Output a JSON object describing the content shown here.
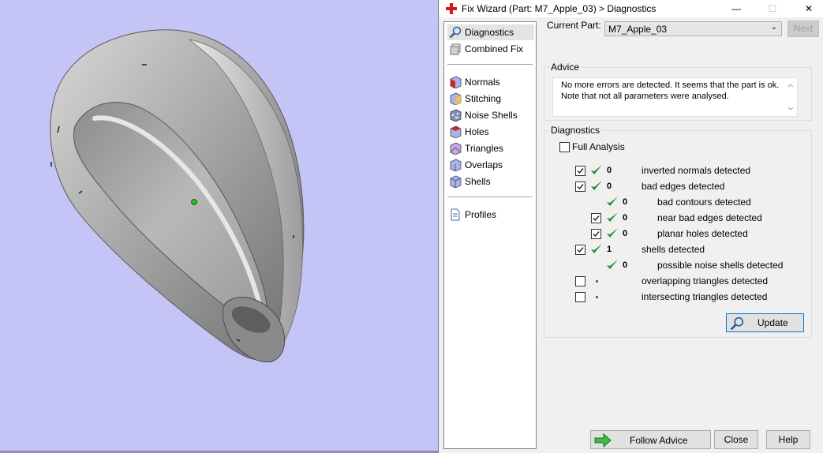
{
  "window": {
    "title": "Fix Wizard (Part: M7_Apple_03) > Diagnostics",
    "minimize": "—",
    "maximize": "☐",
    "close": "✕"
  },
  "nav": {
    "items": [
      {
        "label": "Diagnostics",
        "icon": "magnifier-icon"
      },
      {
        "label": "Combined Fix",
        "icon": "combined-fix-icon"
      },
      {
        "label": "Normals",
        "icon": "normals-icon"
      },
      {
        "label": "Stitching",
        "icon": "stitching-icon"
      },
      {
        "label": "Noise Shells",
        "icon": "noise-shells-icon"
      },
      {
        "label": "Holes",
        "icon": "holes-icon"
      },
      {
        "label": "Triangles",
        "icon": "triangles-icon"
      },
      {
        "label": "Overlaps",
        "icon": "overlaps-icon"
      },
      {
        "label": "Shells",
        "icon": "shells-icon"
      },
      {
        "label": "Profiles",
        "icon": "profiles-icon"
      }
    ],
    "selected": "Diagnostics"
  },
  "header": {
    "current_part_label": "Current Part:",
    "current_part_value": "M7_Apple_03",
    "next_label": "Next"
  },
  "advice": {
    "title": "Advice",
    "line1": "No more errors are detected. It seems that the part is ok.",
    "line2": "Note that not all parameters were analysed."
  },
  "diagnostics": {
    "title": "Diagnostics",
    "full_analysis_label": "Full Analysis",
    "full_analysis_checked": false,
    "rows": [
      {
        "text": "inverted normals detected",
        "count": "0",
        "checkbox": true,
        "checked": true,
        "status": "ok",
        "indent": 0
      },
      {
        "text": "bad edges detected",
        "count": "0",
        "checkbox": true,
        "checked": true,
        "status": "ok",
        "indent": 0
      },
      {
        "text": "bad contours detected",
        "count": "0",
        "checkbox": false,
        "checked": false,
        "status": "ok",
        "indent": 1
      },
      {
        "text": "near bad edges detected",
        "count": "0",
        "checkbox": true,
        "checked": true,
        "status": "ok",
        "indent": 1
      },
      {
        "text": "planar holes detected",
        "count": "0",
        "checkbox": true,
        "checked": true,
        "status": "ok",
        "indent": 1
      },
      {
        "text": "shells detected",
        "count": "1",
        "checkbox": true,
        "checked": true,
        "status": "ok",
        "indent": 0
      },
      {
        "text": "possible noise shells detected",
        "count": "0",
        "checkbox": false,
        "checked": false,
        "status": "ok",
        "indent": 1
      },
      {
        "text": "overlapping triangles detected",
        "count": "",
        "checkbox": true,
        "checked": false,
        "status": "pending",
        "indent": 0
      },
      {
        "text": "intersecting triangles detected",
        "count": "",
        "checkbox": true,
        "checked": false,
        "status": "pending",
        "indent": 0
      }
    ],
    "update_label": "Update"
  },
  "footer": {
    "follow_advice_label": "Follow Advice",
    "close_label": "Close",
    "help_label": "Help"
  },
  "colors": {
    "viewport_bg": "#c4c4f6",
    "check_green": "#1e8f3a",
    "update_border": "#0078d7"
  }
}
